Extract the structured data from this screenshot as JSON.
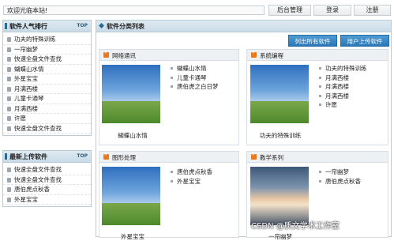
{
  "topbar": {
    "welcome": "欢迎光临本站!",
    "buttons": [
      "后台管理",
      "登录",
      "注册"
    ]
  },
  "popular": {
    "title": "软件人气排行",
    "badge": "TOP",
    "items": [
      "功夫的特殊训练",
      "一帘幽梦",
      "快速全盘文件查找",
      "蝴蝶山水情",
      "外星宝宝",
      "月满西楼",
      "儿童卡通琴",
      "月满西楼",
      "许愿",
      "快速全盘文件查找"
    ]
  },
  "latest": {
    "title": "最新上传软件",
    "badge": "TOP",
    "items": [
      "快速全盘文件查找",
      "快速全盘文件查找",
      "唐伯虎点秋香",
      "外星宝宝"
    ]
  },
  "category": {
    "title": "软件分类列表",
    "btn_all": "列出所有软件",
    "btn_upload": "用户上传软件",
    "panels": [
      {
        "title": "网络通讯",
        "caption": "蝴蝶山水情",
        "items": [
          "蝴蝶山水情",
          "儿童卡通琴",
          "唐伯虎之白日梦"
        ],
        "thumb": "grassland"
      },
      {
        "title": "系统编程",
        "caption": "功夫的特殊训练",
        "items": [
          "功夫的特殊训练",
          "月满西楼",
          "月满西楼",
          "月满西楼",
          "许愿"
        ],
        "thumb": "grassland"
      },
      {
        "title": "图形处理",
        "caption": "外星宝宝",
        "items": [
          "唐伯虎点秋香",
          "外星宝宝"
        ],
        "thumb": "grassland"
      },
      {
        "title": "教学系列",
        "caption": "一帘幽梦",
        "items": [
          "一帘幽梦",
          "唐伯虎点秋香"
        ],
        "thumb": "sunset"
      }
    ]
  },
  "watermark": "CSDN @质文学术工作室"
}
